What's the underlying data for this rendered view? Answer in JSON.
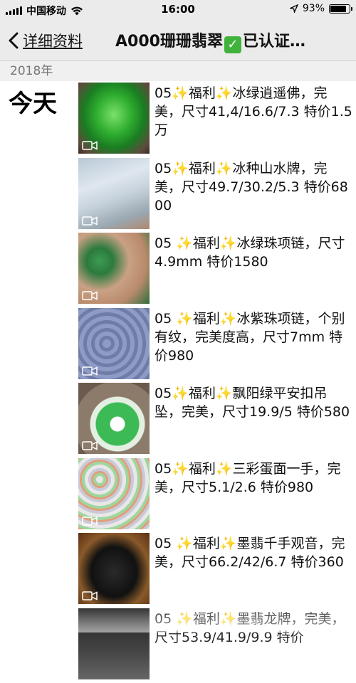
{
  "status_bar": {
    "carrier": "中国移动",
    "time": "16:00",
    "battery": "93%",
    "battery_level": 0.93
  },
  "nav": {
    "back_label": "详细资料",
    "title_prefix": "A000珊珊翡翠",
    "title_suffix": "已认证…"
  },
  "year": "2018年",
  "day": "今天",
  "posts": [
    {
      "text": "05✨福利✨冰绿逍遥佛，完美，尺寸41,4/16.6/7.3 特价1.5万"
    },
    {
      "text": "05✨福利✨冰种山水牌，完美，尺寸49.7/30.2/5.3 特价6800"
    },
    {
      "text": "05 ✨福利✨冰绿珠项链，尺寸4.9mm 特价1580"
    },
    {
      "text": "05 ✨福利✨冰紫珠项链，个别有纹，完美度高，尺寸7mm 特价980"
    },
    {
      "text": "05✨福利✨飘阳绿平安扣吊坠，完美，尺寸19.9/5 特价580"
    },
    {
      "text": "05✨福利✨三彩蛋面一手，完美，尺寸5.1/2.6 特价980"
    },
    {
      "text": "05 ✨福利✨墨翡千手观音，完美，尺寸66.2/42/6.7 特价360"
    },
    {
      "text": "05 ✨福利✨墨翡龙牌，完美，尺寸53.9/41.9/9.9 特价"
    }
  ]
}
